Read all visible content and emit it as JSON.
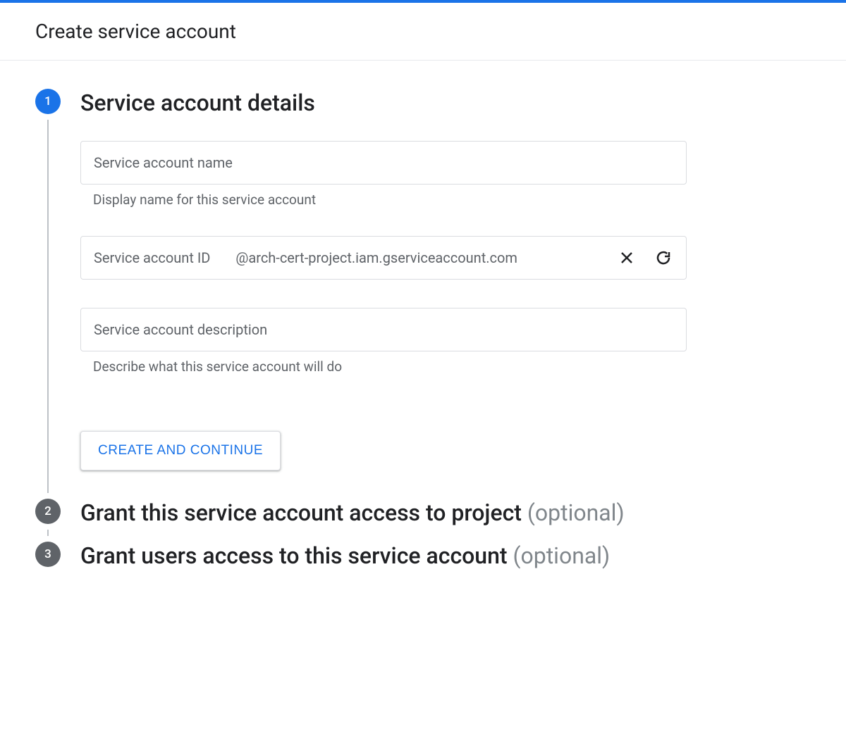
{
  "header": {
    "title": "Create service account"
  },
  "steps": {
    "step1": {
      "number": "1",
      "title": "Service account details",
      "name_field": {
        "label": "Service account name",
        "helper": "Display name for this service account"
      },
      "id_field": {
        "label": "Service account ID",
        "suffix": "@arch-cert-project.iam.gserviceaccount.com"
      },
      "desc_field": {
        "label": "Service account description",
        "helper": "Describe what this service account will do"
      },
      "button": "CREATE AND CONTINUE"
    },
    "step2": {
      "number": "2",
      "title": "Grant this service account access to project",
      "optional": "(optional)"
    },
    "step3": {
      "number": "3",
      "title": "Grant users access to this service account",
      "optional": "(optional)"
    }
  }
}
